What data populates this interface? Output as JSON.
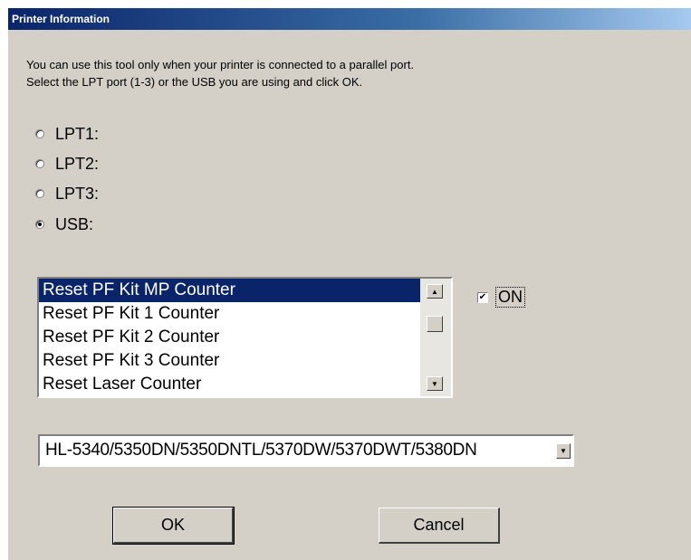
{
  "window": {
    "title": "Printer Information"
  },
  "description": {
    "line1": "You can use this tool only when your printer is connected to a parallel port.",
    "line2": "Select the LPT port (1-3) or the USB you are using and click OK."
  },
  "ports": [
    {
      "label": "LPT1:",
      "checked": false
    },
    {
      "label": "LPT2:",
      "checked": false
    },
    {
      "label": "LPT3:",
      "checked": false
    },
    {
      "label": "USB:",
      "checked": true
    }
  ],
  "counter_list": {
    "items": [
      {
        "label": "Reset PF Kit MP Counter",
        "selected": true
      },
      {
        "label": "Reset PF Kit 1 Counter",
        "selected": false
      },
      {
        "label": "Reset PF Kit 2 Counter",
        "selected": false
      },
      {
        "label": "Reset PF Kit 3 Counter",
        "selected": false
      },
      {
        "label": "Reset Laser Counter",
        "selected": false
      }
    ]
  },
  "on_checkbox": {
    "label": "ON",
    "checked": true,
    "mark": "✔"
  },
  "model_select": {
    "value": "HL-5340/5350DN/5350DNTL/5370DW/5370DWT/5380DN"
  },
  "buttons": {
    "ok": "OK",
    "cancel": "Cancel"
  },
  "glyphs": {
    "up": "▲",
    "down": "▼"
  }
}
